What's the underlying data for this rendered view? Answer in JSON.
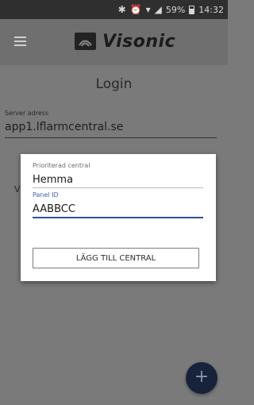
{
  "status_bar": {
    "bluetooth_icon": "bluetooth-icon",
    "alarm_icon": "alarm-icon",
    "wifi_icon": "wifi-icon",
    "signal_icon": "signal-icon",
    "battery_percent": "59%",
    "battery_icon": "battery-icon",
    "time": "14:32"
  },
  "app_bar": {
    "menu_icon": "hamburger-menu-icon",
    "logo_mark_icon": "visonic-logo-mark",
    "logo_text": "Visonic"
  },
  "login": {
    "title": "Login",
    "server_label": "Server adress",
    "server_value": "app1.lflarmcentral.se",
    "partial_char": "V"
  },
  "dialog": {
    "central_label": "Prioriterad central",
    "central_value": "Hemma",
    "panel_label": "Panel ID",
    "panel_value": "AABBCC",
    "button_label": "LÄGG TILL CENTRAL"
  },
  "fab": {
    "icon": "plus-icon",
    "symbol": "+"
  },
  "colors": {
    "overlay_bg": "#7a7a7a",
    "accent": "#2f4f9d",
    "fab_bg": "#17233a"
  }
}
